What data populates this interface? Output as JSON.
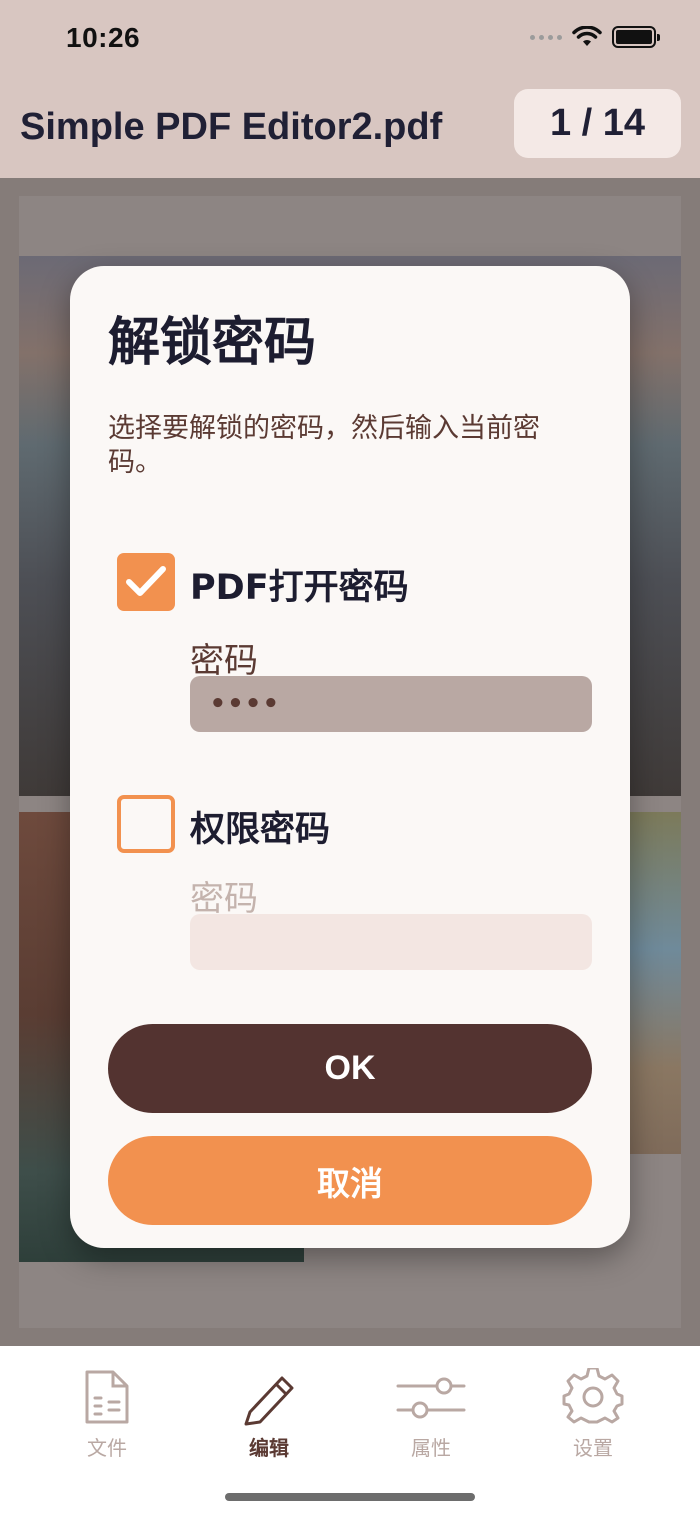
{
  "status_bar": {
    "time": "10:26"
  },
  "header": {
    "title": "Simple PDF Editor2.pdf",
    "page_indicator": "1 / 14"
  },
  "dialog": {
    "title": "解锁密码",
    "description": "选择要解锁的密码，然后输入当前密码。",
    "options": [
      {
        "label": "PDF打开密码",
        "checked": true,
        "field_label": "密码",
        "value": "••••"
      },
      {
        "label": "权限密码",
        "checked": false,
        "field_label": "密码",
        "value": ""
      }
    ],
    "ok_label": "OK",
    "cancel_label": "取消"
  },
  "tabbar": {
    "items": [
      {
        "label": "文件",
        "icon": "file-icon",
        "active": false
      },
      {
        "label": "编辑",
        "icon": "pencil-icon",
        "active": true
      },
      {
        "label": "属性",
        "icon": "sliders-icon",
        "active": false
      },
      {
        "label": "设置",
        "icon": "gear-icon",
        "active": false
      }
    ]
  },
  "colors": {
    "accent": "#f2914f",
    "primary_dark": "#533330",
    "header_bg": "#d8c6c1",
    "text_dark": "#1d1d30"
  }
}
